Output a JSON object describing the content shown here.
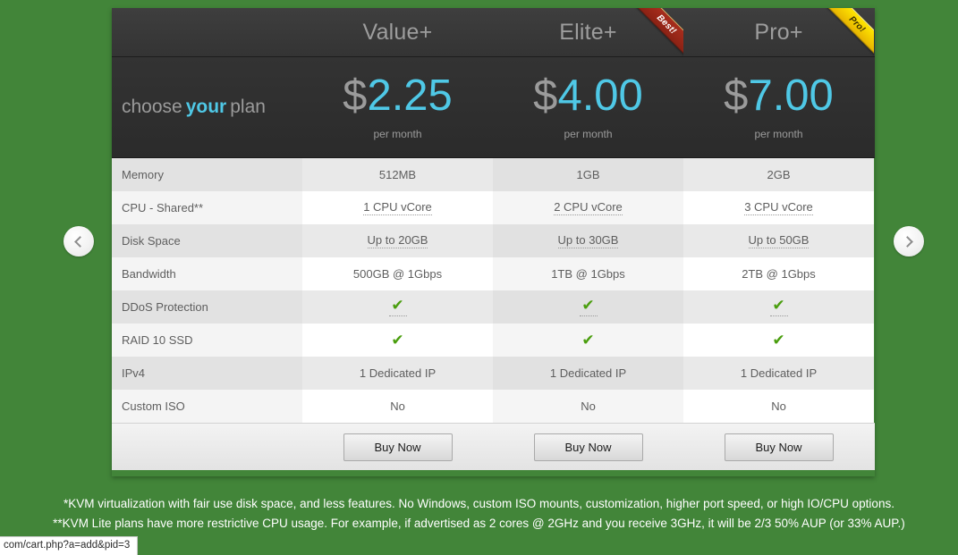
{
  "page": {
    "background_color": "#428539",
    "accent_color": "#4fc8e6",
    "check_color": "#4a9e0e"
  },
  "nav": {
    "prev_icon": "chevron-left-icon",
    "next_icon": "chevron-right-icon"
  },
  "header": {
    "tagline_pre": "choose",
    "tagline_hl": "your",
    "tagline_post": "plan",
    "currency": "$",
    "per_month": "per month"
  },
  "plans": [
    {
      "name": "Value+",
      "price": "2.25",
      "ribbon": null,
      "buy_label": "Buy Now"
    },
    {
      "name": "Elite+",
      "price": "4.00",
      "ribbon": "Best!",
      "buy_label": "Buy Now"
    },
    {
      "name": "Pro+",
      "price": "7.00",
      "ribbon": "Pro!",
      "buy_label": "Buy Now"
    }
  ],
  "rows": [
    {
      "label": "Memory",
      "values": [
        "512MB",
        "1GB",
        "2GB"
      ],
      "tooltip": false,
      "check": false
    },
    {
      "label": "CPU - Shared**",
      "values": [
        "1 CPU vCore",
        "2 CPU vCore",
        "3 CPU vCore"
      ],
      "tooltip": true,
      "check": false
    },
    {
      "label": "Disk Space",
      "values": [
        "Up to 20GB",
        "Up to 30GB",
        "Up to 50GB"
      ],
      "tooltip": true,
      "check": false
    },
    {
      "label": "Bandwidth",
      "values": [
        "500GB @ 1Gbps",
        "1TB @ 1Gbps",
        "2TB @ 1Gbps"
      ],
      "tooltip": false,
      "check": false
    },
    {
      "label": "DDoS Protection",
      "values": [
        "✔",
        "✔",
        "✔"
      ],
      "tooltip": true,
      "check": true
    },
    {
      "label": "RAID 10 SSD",
      "values": [
        "✔",
        "✔",
        "✔"
      ],
      "tooltip": false,
      "check": true
    },
    {
      "label": "IPv4",
      "values": [
        "1 Dedicated IP",
        "1 Dedicated IP",
        "1 Dedicated IP"
      ],
      "tooltip": false,
      "check": false
    },
    {
      "label": "Custom ISO",
      "values": [
        "No",
        "No",
        "No"
      ],
      "tooltip": false,
      "check": false
    }
  ],
  "notes": {
    "line1": "*KVM virtualization with fair use disk space, and less features. No Windows, custom ISO mounts, customization, higher port speed, or high IO/CPU options.",
    "line2": "**KVM Lite plans have more restrictive CPU usage. For example, if advertised as 2 cores @ 2GHz and you receive 3GHz, it will be 2/3 50% AUP (or 33% AUP.)"
  },
  "statusbar": {
    "url": "com/cart.php?a=add&pid=3"
  }
}
